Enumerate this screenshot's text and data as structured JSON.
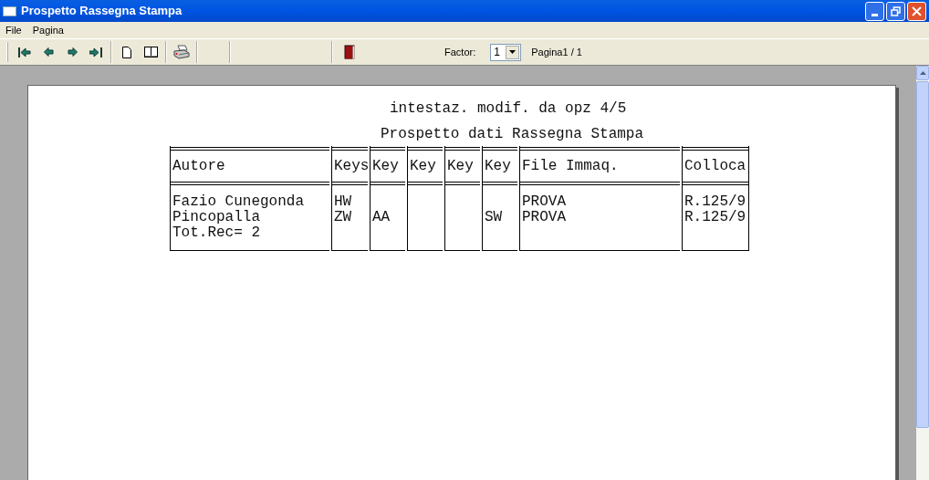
{
  "window": {
    "title": "Prospetto Rassegna Stampa"
  },
  "menu": [
    "File",
    "Pagina"
  ],
  "toolbar": {
    "factor_label": "Factor:",
    "factor_value": "1",
    "page_info": "Pagina1 / 1"
  },
  "report": {
    "heading": "intestaz. modif. da opz 4/5",
    "title": "Prospetto dati Rassegna Stampa",
    "table": {
      "columns": [
        "Autore",
        "Keys",
        "Key",
        "Key",
        "Key",
        "Key",
        "File Immaq.",
        "Colloca"
      ],
      "rows": [
        [
          "Fazio Cunegonda",
          "HW",
          null,
          null,
          null,
          null,
          "PROVA",
          "R.125/9"
        ],
        [
          "Pincopalla",
          "ZW",
          "AA",
          null,
          null,
          "SW",
          "PROVA",
          "R.125/9"
        ],
        [
          "Tot.Rec= 2"
        ]
      ]
    }
  }
}
